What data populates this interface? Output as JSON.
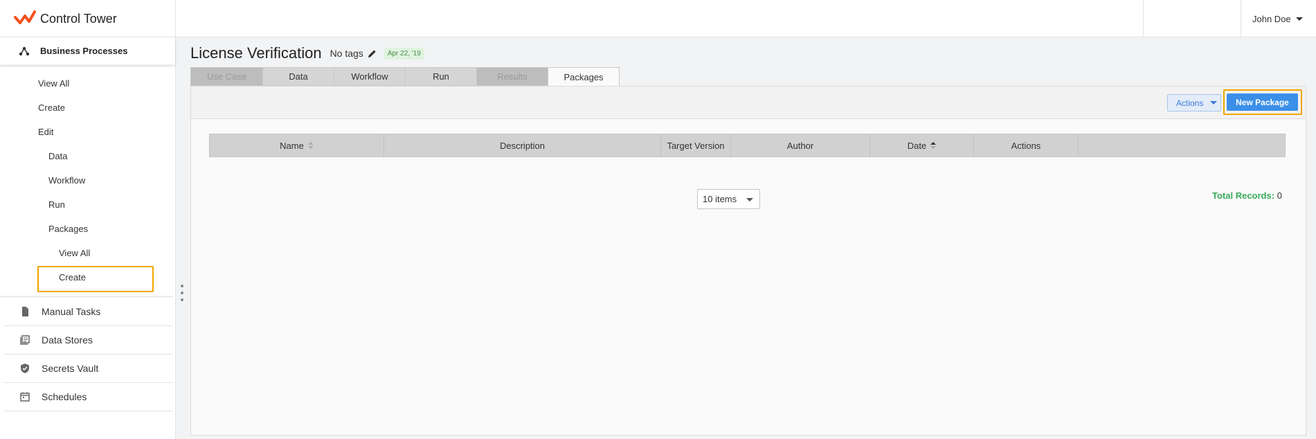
{
  "app": {
    "title": "Control Tower",
    "brand_color": "#f4511e"
  },
  "user": {
    "name": "John Doe"
  },
  "sidebar": {
    "section_title": "Business Processes",
    "section_icon": "hierarchy-icon",
    "sub_items": [
      {
        "label": "View All",
        "level": 1
      },
      {
        "label": "Create",
        "level": 1
      },
      {
        "label": "Edit",
        "level": 1
      },
      {
        "label": "Data",
        "level": 2
      },
      {
        "label": "Workflow",
        "level": 2
      },
      {
        "label": "Run",
        "level": 2
      },
      {
        "label": "Packages",
        "level": 2
      },
      {
        "label": "View All",
        "level": 3
      },
      {
        "label": "Create",
        "level": 3
      }
    ],
    "main_items": [
      {
        "label": "Manual Tasks",
        "icon": "document-icon"
      },
      {
        "label": "Data Stores",
        "icon": "stack-icon"
      },
      {
        "label": "Secrets Vault",
        "icon": "shield-icon"
      },
      {
        "label": "Schedules",
        "icon": "calendar-icon"
      }
    ]
  },
  "page": {
    "title": "License Verification",
    "tags_label": "No tags",
    "date_badge": "Apr 22, '19"
  },
  "tabs": [
    {
      "label": "Use Case",
      "state": "disabled"
    },
    {
      "label": "Data",
      "state": "normal"
    },
    {
      "label": "Workflow",
      "state": "normal"
    },
    {
      "label": "Run",
      "state": "normal"
    },
    {
      "label": "Results",
      "state": "disabled"
    },
    {
      "label": "Packages",
      "state": "active"
    }
  ],
  "toolbar": {
    "actions_label": "Actions",
    "new_package_label": "New Package"
  },
  "table": {
    "columns": [
      {
        "label": "Name",
        "sortable": true,
        "sort": "none"
      },
      {
        "label": "Description",
        "sortable": false
      },
      {
        "label": "Target Version",
        "sortable": false
      },
      {
        "label": "Author",
        "sortable": false
      },
      {
        "label": "Date",
        "sortable": true,
        "sort": "asc"
      },
      {
        "label": "Actions",
        "sortable": false
      }
    ],
    "rows": []
  },
  "pagination": {
    "page_size_label": "10 items",
    "total_label": "Total Records:",
    "total_value": "0"
  },
  "colors": {
    "accent": "#3b8fe8",
    "highlight": "#f0a500",
    "success": "#3aaa5c"
  }
}
